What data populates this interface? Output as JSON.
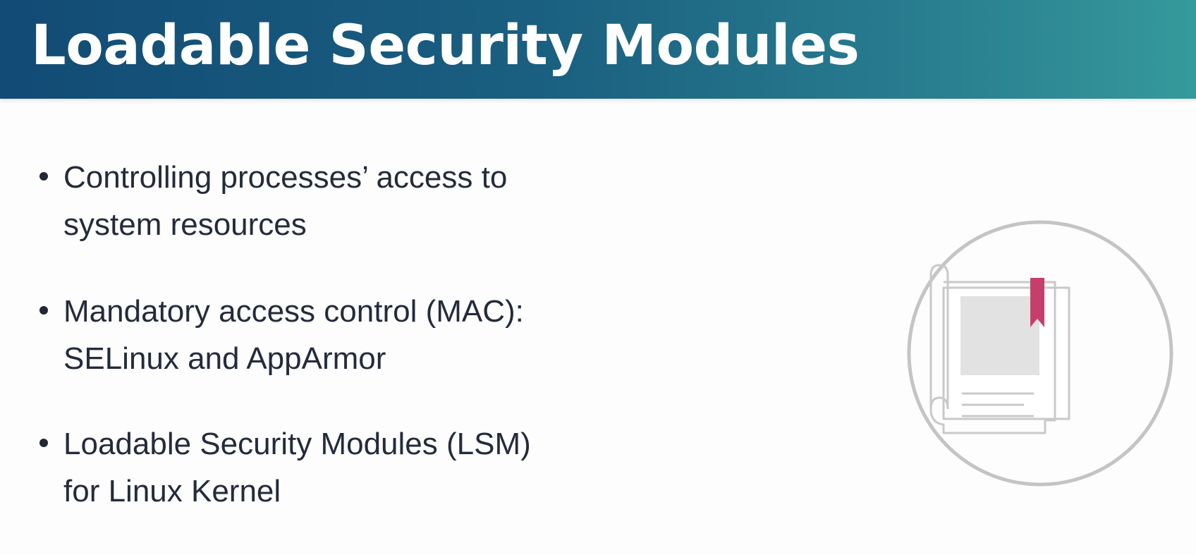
{
  "slide": {
    "title": "Loadable Security Modules",
    "bullets": [
      {
        "lines": [
          "Controlling processes’ access to",
          "system resources"
        ]
      },
      {
        "lines": [
          "Mandatory access control (MAC):",
          "SELinux and AppArmor"
        ]
      },
      {
        "lines": [
          "Loadable Security Modules (LSM)",
          "for Linux Kernel"
        ]
      }
    ],
    "icon": {
      "name": "document-bookmark-icon",
      "ring_color": "#c4c4c4",
      "page_outline_color": "#c9c9c9",
      "image_placeholder_color": "#e2e2e2",
      "bookmark_color": "#c63f6a"
    }
  },
  "colors": {
    "header_gradient_start": "#124b75",
    "header_gradient_end": "#359a9c",
    "title_text": "#ffffff",
    "body_text": "#242b3b",
    "background": "#fdfdfd"
  }
}
